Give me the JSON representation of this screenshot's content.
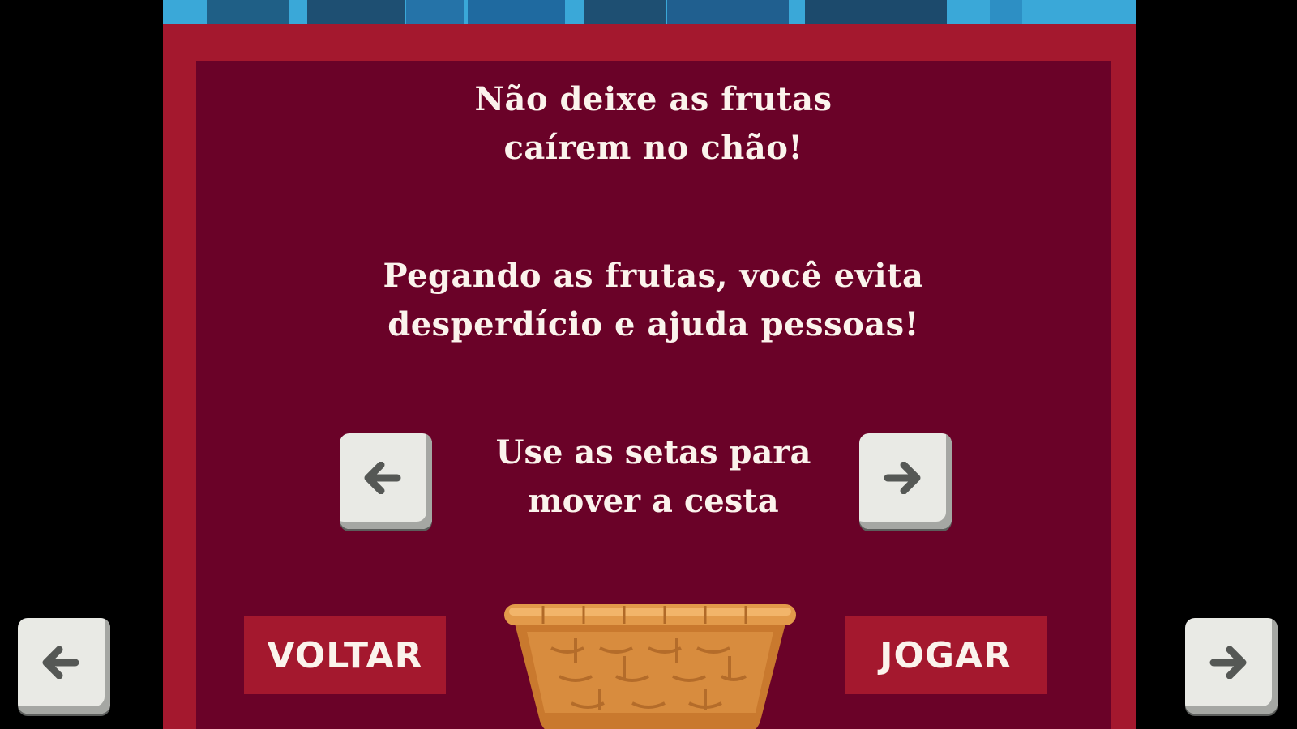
{
  "panel": {
    "message_1_line_1": "Não deixe as frutas",
    "message_1_line_2": "caírem no chão!",
    "message_2_line_1": "Pegando as frutas, você evita",
    "message_2_line_2": "desperdício e ajuda pessoas!",
    "instruction_line_1": "Use as setas para",
    "instruction_line_2": "mover a cesta"
  },
  "buttons": {
    "back_label": "VOLTAR",
    "play_label": "JOGAR"
  },
  "icons": {
    "left_arrow": "arrow-left-key-icon",
    "right_arrow": "arrow-right-key-icon",
    "basket": "basket-icon"
  },
  "colors": {
    "background": "#000000",
    "frame": "#a4182e",
    "panel": "#6a0228",
    "text": "#fbf3ec",
    "key": "#e9eae5",
    "sky": "#3aa8d8"
  }
}
